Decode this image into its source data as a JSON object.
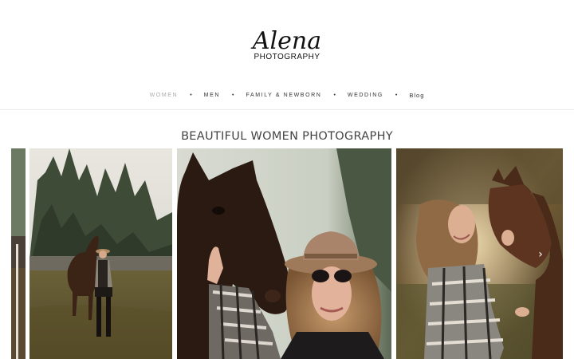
{
  "logo": {
    "script": "Alena",
    "subtitle": "PHOTOGRAPHY"
  },
  "nav": {
    "items": [
      {
        "label": "WOMEN",
        "active": true
      },
      {
        "label": "MEN",
        "active": false
      },
      {
        "label": "FAMILY & NEWBORN",
        "active": false
      },
      {
        "label": "WEDDING",
        "active": false
      },
      {
        "label": "Blog",
        "active": false
      }
    ],
    "separator": "•"
  },
  "gallery": {
    "title": "BEAUTIFUL WOMEN PHOTOGRAPHY",
    "next_arrow": "›",
    "photos": [
      "photo-partial-left",
      "photo-woman-horse-field",
      "photo-woman-hat-horse",
      "photo-woman-horse-sunset"
    ]
  },
  "colors": {
    "nav_active": "#aaaaaa",
    "text": "#333333",
    "title": "#444444"
  }
}
